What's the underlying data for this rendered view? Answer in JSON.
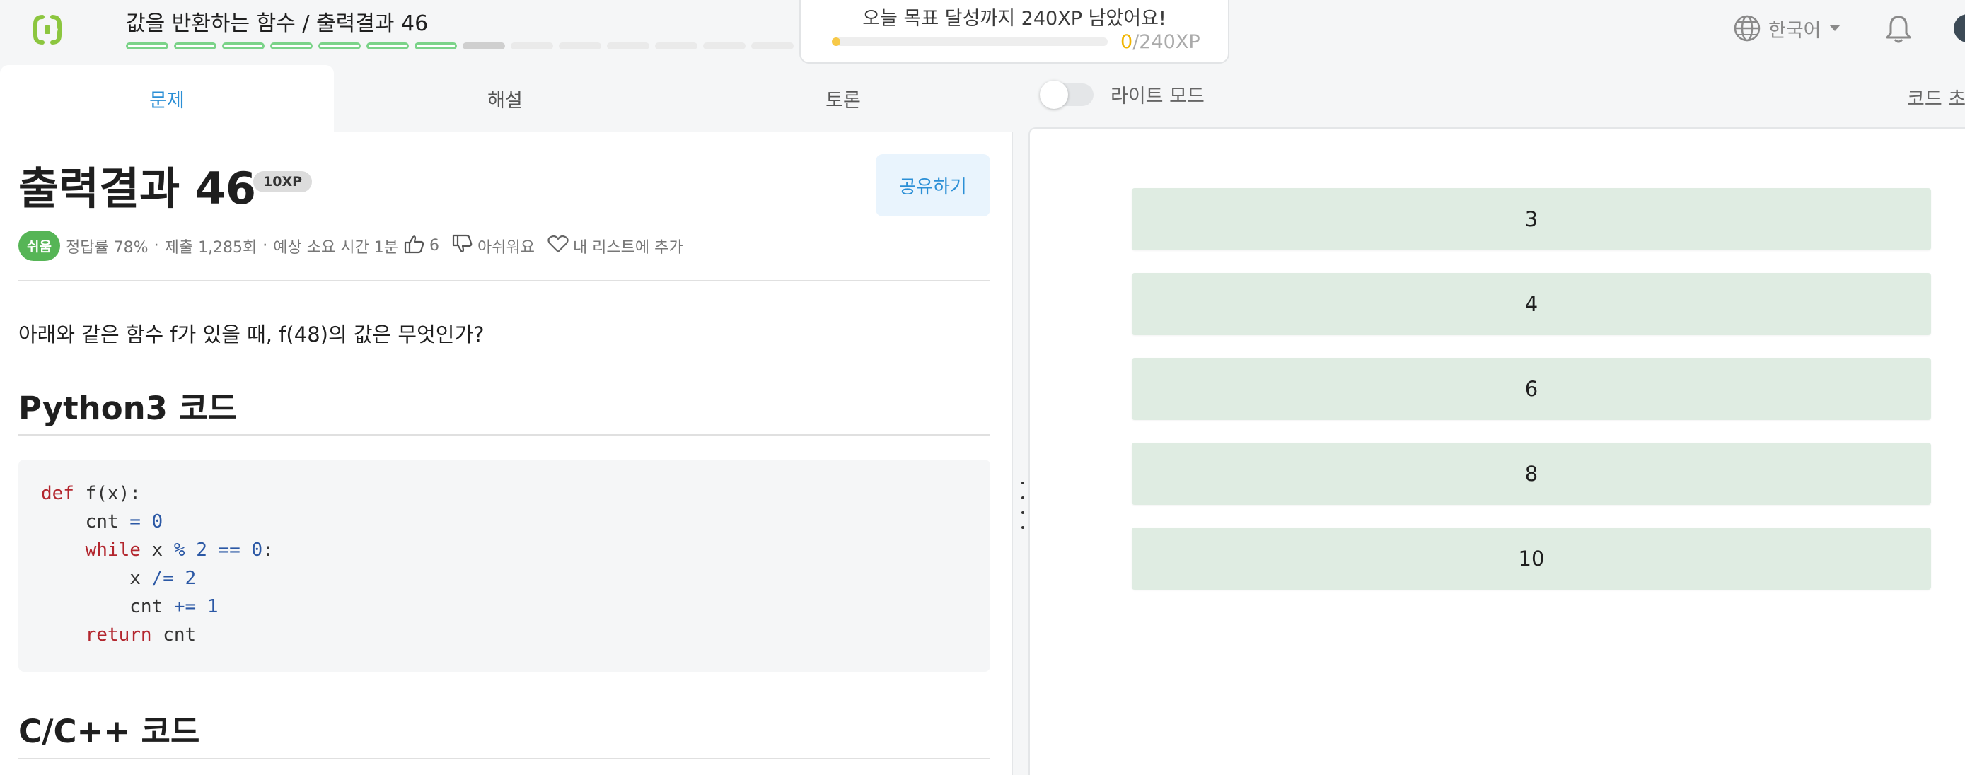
{
  "header": {
    "lesson_title": "값을 반환하는 함수 / 출력결과 46",
    "steps": [
      "done",
      "done",
      "done",
      "done",
      "done",
      "done",
      "done",
      "current",
      "todo",
      "todo",
      "todo",
      "todo",
      "todo",
      "todo"
    ],
    "goal": {
      "message": "오늘 목표 달성까지 240XP 남았어요!",
      "current": "0",
      "total": "/240XP",
      "progress_fraction": 0
    },
    "language_label": "한국어",
    "icons": [
      "logo-icon",
      "globe-icon",
      "caret-down-icon",
      "bell-icon",
      "avatar"
    ]
  },
  "tabs": [
    {
      "label": "문제",
      "active": true
    },
    {
      "label": "해설",
      "active": false
    },
    {
      "label": "토론",
      "active": false
    }
  ],
  "light_mode": {
    "label": "라이트 모드",
    "on": false
  },
  "code_init_label": "코드 초",
  "problem": {
    "title": "출력결과 46",
    "xp_badge": "10XP",
    "share_label": "공유하기",
    "level": "쉬움",
    "accuracy": "정답률 78%",
    "submissions": "제출 1,285회",
    "time": "예상 소요 시간 1분",
    "likes": "6",
    "dislike_label": "아쉬워요",
    "add_list_label": "내 리스트에 추가",
    "question": "아래와 같은 함수 f가 있을 때, f(48)의 값은 무엇인가?",
    "python_heading": "Python3 코드",
    "c_heading": "C/C++ 코드",
    "code_lines": [
      [
        {
          "t": "def",
          "c": "kw"
        },
        {
          "t": " f(x):",
          "c": ""
        }
      ],
      [
        {
          "t": "    cnt ",
          "c": ""
        },
        {
          "t": "=",
          "c": "op"
        },
        {
          "t": " ",
          "c": ""
        },
        {
          "t": "0",
          "c": "op"
        }
      ],
      [
        {
          "t": "    ",
          "c": ""
        },
        {
          "t": "while",
          "c": "kw"
        },
        {
          "t": " x ",
          "c": ""
        },
        {
          "t": "%",
          "c": "op"
        },
        {
          "t": " ",
          "c": ""
        },
        {
          "t": "2",
          "c": "op"
        },
        {
          "t": " ",
          "c": ""
        },
        {
          "t": "==",
          "c": "op"
        },
        {
          "t": " ",
          "c": ""
        },
        {
          "t": "0",
          "c": "op"
        },
        {
          "t": ":",
          "c": ""
        }
      ],
      [
        {
          "t": "        x ",
          "c": ""
        },
        {
          "t": "/=",
          "c": "op"
        },
        {
          "t": " ",
          "c": ""
        },
        {
          "t": "2",
          "c": "op"
        }
      ],
      [
        {
          "t": "        cnt ",
          "c": ""
        },
        {
          "t": "+=",
          "c": "op"
        },
        {
          "t": " ",
          "c": ""
        },
        {
          "t": "1",
          "c": "op"
        }
      ],
      [
        {
          "t": "    ",
          "c": ""
        },
        {
          "t": "return",
          "c": "kw"
        },
        {
          "t": " cnt",
          "c": ""
        }
      ]
    ]
  },
  "choices": [
    "3",
    "4",
    "6",
    "8",
    "10"
  ],
  "colors": {
    "accent": "#2b8fd6",
    "level_green": "#56b556",
    "choice_bg": "#dfece2",
    "step_done": "#7bd389",
    "goal_gold": "#f0b400"
  }
}
